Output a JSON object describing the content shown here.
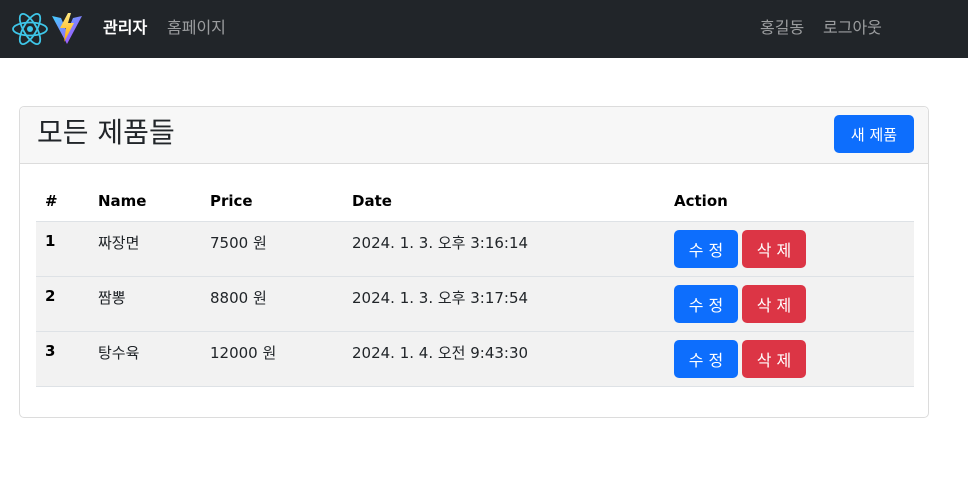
{
  "navbar": {
    "logo_react_icon": "react-logo-icon",
    "logo_vite_icon": "vite-logo-icon",
    "admin_label": "관리자",
    "home_label": "홈페이지",
    "user_label": "홍길동",
    "logout_label": "로그아웃"
  },
  "card": {
    "title": "모든 제품들",
    "new_button_label": "새 제품"
  },
  "table": {
    "headers": [
      "#",
      "Name",
      "Price",
      "Date",
      "Action"
    ],
    "rows": [
      {
        "num": "1",
        "name": "짜장면",
        "price": "7500 원",
        "date": "2024. 1. 3. 오후 3:16:14",
        "edit_label": "수 정",
        "delete_label": "삭 제"
      },
      {
        "num": "2",
        "name": "짬뽕",
        "price": "8800 원",
        "date": "2024. 1. 3. 오후 3:17:54",
        "edit_label": "수 정",
        "delete_label": "삭 제"
      },
      {
        "num": "3",
        "name": "탕수육",
        "price": "12000 원",
        "date": "2024. 1. 4. 오전 9:43:30",
        "edit_label": "수 정",
        "delete_label": "삭 제"
      }
    ]
  },
  "colors": {
    "navbar_bg": "#212529",
    "primary": "#0d6efd",
    "danger": "#dc3545"
  }
}
